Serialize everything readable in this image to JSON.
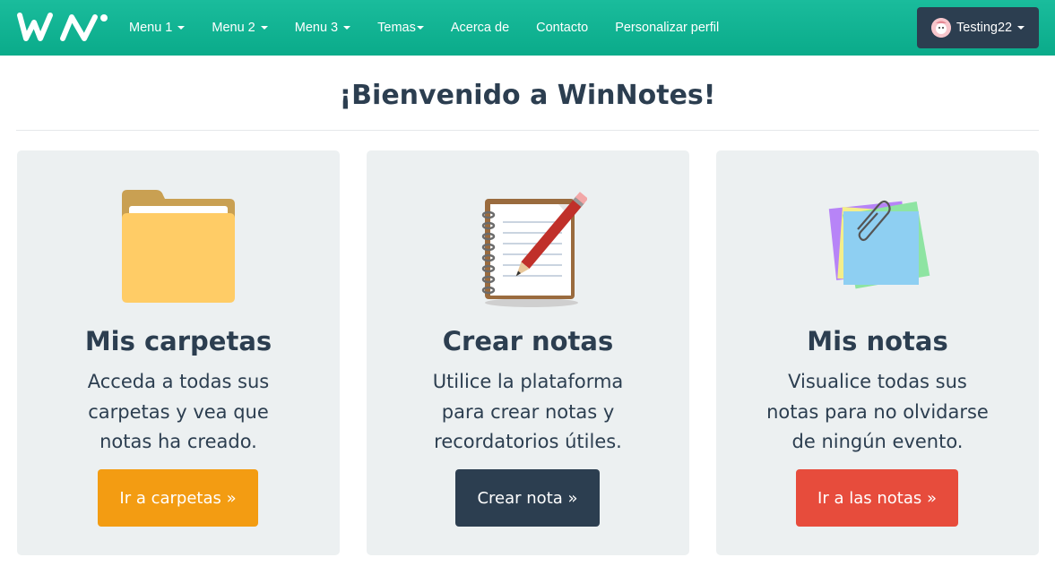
{
  "navbar": {
    "brand": "WN",
    "items": [
      {
        "label": "Menu 1",
        "dropdown": true
      },
      {
        "label": "Menu 2",
        "dropdown": true
      },
      {
        "label": "Menu 3",
        "dropdown": true
      },
      {
        "label": "Temas",
        "dropdown": true
      },
      {
        "label": "Acerca de",
        "dropdown": false
      },
      {
        "label": "Contacto",
        "dropdown": false
      },
      {
        "label": "Personalizar perfil",
        "dropdown": false
      }
    ],
    "user": {
      "name": "Testing22"
    }
  },
  "main": {
    "title": "¡Bienvenido a WinNotes!",
    "cards": [
      {
        "title": "Mis carpetas",
        "lines": [
          "Acceda a todas sus",
          "carpetas y vea que",
          "notas ha creado."
        ],
        "button": "Ir a carpetas »",
        "icon": "folder-icon",
        "button_color": "#f39c12"
      },
      {
        "title": "Crear notas",
        "lines": [
          "Utilice la plataforma",
          "para crear notas y",
          "recordatorios útiles."
        ],
        "button": "Crear nota »",
        "icon": "notebook-pencil-icon",
        "button_color": "#2c3e50"
      },
      {
        "title": "Mis notas",
        "lines": [
          "Visualice todas sus",
          "notas para no olvidarse",
          "de ningún evento."
        ],
        "button": "Ir a las notas »",
        "icon": "sticky-notes-icon",
        "button_color": "#e74c3c"
      }
    ]
  },
  "colors": {
    "navbar": "#1abc9c",
    "primary": "#2c3e50",
    "card_bg": "#ecf0f1"
  }
}
